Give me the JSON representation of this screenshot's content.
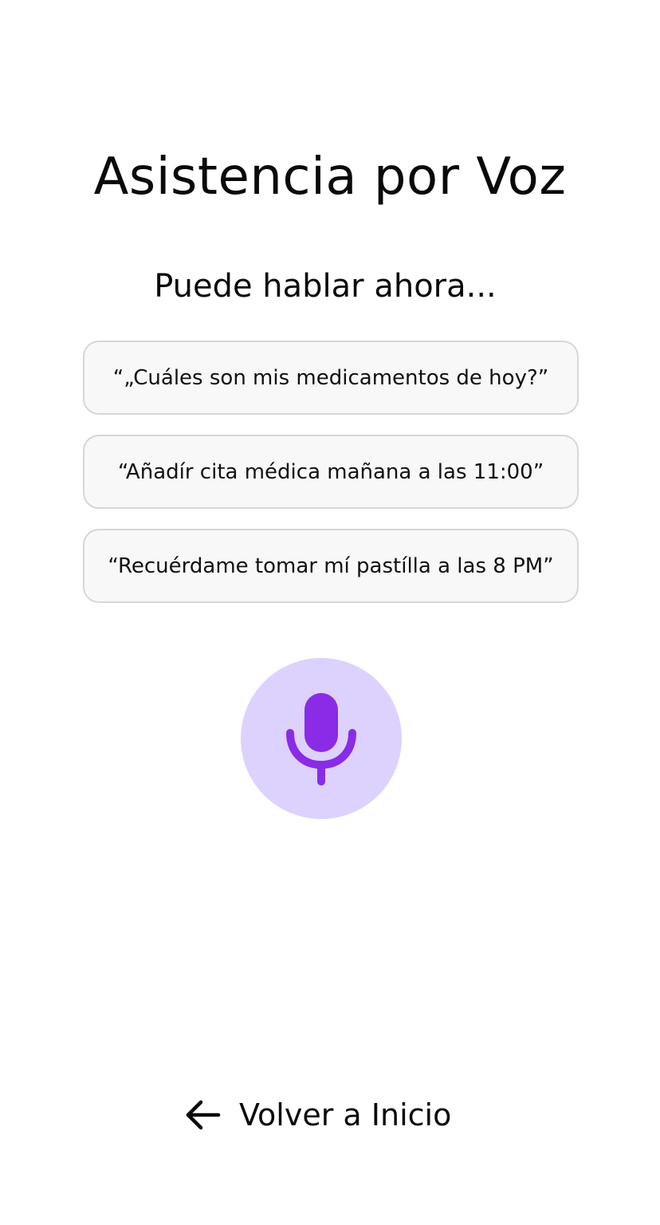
{
  "header": {
    "title": "Asistencia por Voz",
    "subtitle": "Puede hablar ahora..."
  },
  "suggestions": [
    {
      "text": "“„Cuáles son mis medicamentos de hoy?”"
    },
    {
      "text": "“Añadír cita médica mañana a las 11:00”"
    },
    {
      "text": "“Recuérdame tomar mí pastílla a las 8 PM”"
    }
  ],
  "mic": {
    "icon": "microphone-icon",
    "accent_color": "#8a2be8",
    "background_color": "#ddd2fe"
  },
  "footer": {
    "back_icon": "arrow-left-icon",
    "back_label": "Volver a Inicio"
  }
}
